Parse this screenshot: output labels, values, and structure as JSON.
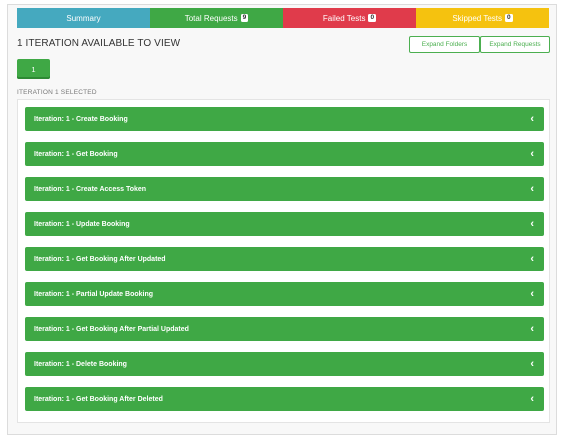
{
  "tabs": {
    "summary": {
      "label": "Summary",
      "color": "#45a9bf"
    },
    "total_requests": {
      "label": "Total Requests",
      "count": "9",
      "color": "#3fa845"
    },
    "failed_tests": {
      "label": "Failed Tests",
      "count": "0",
      "color": "#e03b4b"
    },
    "skipped_tests": {
      "label": "Skipped Tests",
      "count": "0",
      "color": "#f5c20f"
    }
  },
  "heading": "1 ITERATION AVAILABLE TO VIEW",
  "buttons": {
    "expand_folders": "Expand Folders",
    "expand_requests": "Expand Requests"
  },
  "iteration_button": "1",
  "iteration_selected": "ITERATION 1 SELECTED",
  "rows": [
    {
      "label": "Iteration: 1 - Create Booking",
      "icon": "chevron-left-icon"
    },
    {
      "label": "Iteration: 1 - Get Booking",
      "icon": "chevron-left-icon"
    },
    {
      "label": "Iteration: 1 - Create Access Token",
      "icon": "chevron-left-icon"
    },
    {
      "label": "Iteration: 1 - Update Booking",
      "icon": "chevron-left-icon"
    },
    {
      "label": "Iteration: 1 - Get Booking After Updated",
      "icon": "chevron-left-icon"
    },
    {
      "label": "Iteration: 1 - Partial Update Booking",
      "icon": "chevron-left-icon"
    },
    {
      "label": "Iteration: 1 - Get Booking After Partial Updated",
      "icon": "chevron-left-icon"
    },
    {
      "label": "Iteration: 1 - Delete Booking",
      "icon": "chevron-left-icon"
    },
    {
      "label": "Iteration: 1 - Get Booking After Deleted",
      "icon": "chevron-left-icon"
    }
  ],
  "colors": {
    "row_green": "#3fa845",
    "outline_green": "#4caf50"
  }
}
